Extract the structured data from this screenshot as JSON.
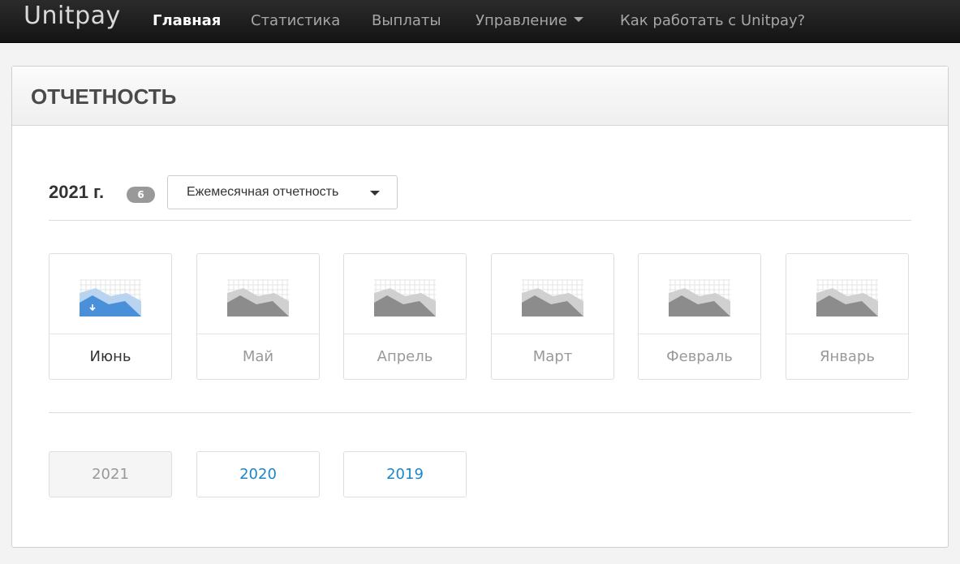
{
  "nav": {
    "logo": "Unitpay",
    "items": [
      {
        "label": "Главная",
        "active": true
      },
      {
        "label": "Статистика",
        "active": false
      },
      {
        "label": "Выплаты",
        "active": false
      },
      {
        "label": "Управление",
        "active": false,
        "dropdown": true
      },
      {
        "label": "Как работать с Unitpay?",
        "active": false
      }
    ]
  },
  "panel": {
    "title": "ОТЧЕТНОСТЬ"
  },
  "report": {
    "year_title": "2021 г.",
    "count": "6",
    "type_select": "Ежемесячная отчетность",
    "months": [
      {
        "label": "Июнь",
        "active": true,
        "icon": "chart-download-icon"
      },
      {
        "label": "Май",
        "active": false,
        "icon": "chart-icon"
      },
      {
        "label": "Апрель",
        "active": false,
        "icon": "chart-icon"
      },
      {
        "label": "Март",
        "active": false,
        "icon": "chart-icon"
      },
      {
        "label": "Февраль",
        "active": false,
        "icon": "chart-icon"
      },
      {
        "label": "Январь",
        "active": false,
        "icon": "chart-icon"
      }
    ],
    "years": [
      {
        "label": "2021",
        "current": true
      },
      {
        "label": "2020",
        "current": false
      },
      {
        "label": "2019",
        "current": false
      }
    ]
  },
  "colors": {
    "navbar": "#1e1e1e",
    "link": "#1a87c9",
    "active_chart_front": "#4a90d9",
    "active_chart_back": "#b8d4f0",
    "chart_front": "#8c8c8c",
    "chart_back": "#d0d0d0"
  }
}
